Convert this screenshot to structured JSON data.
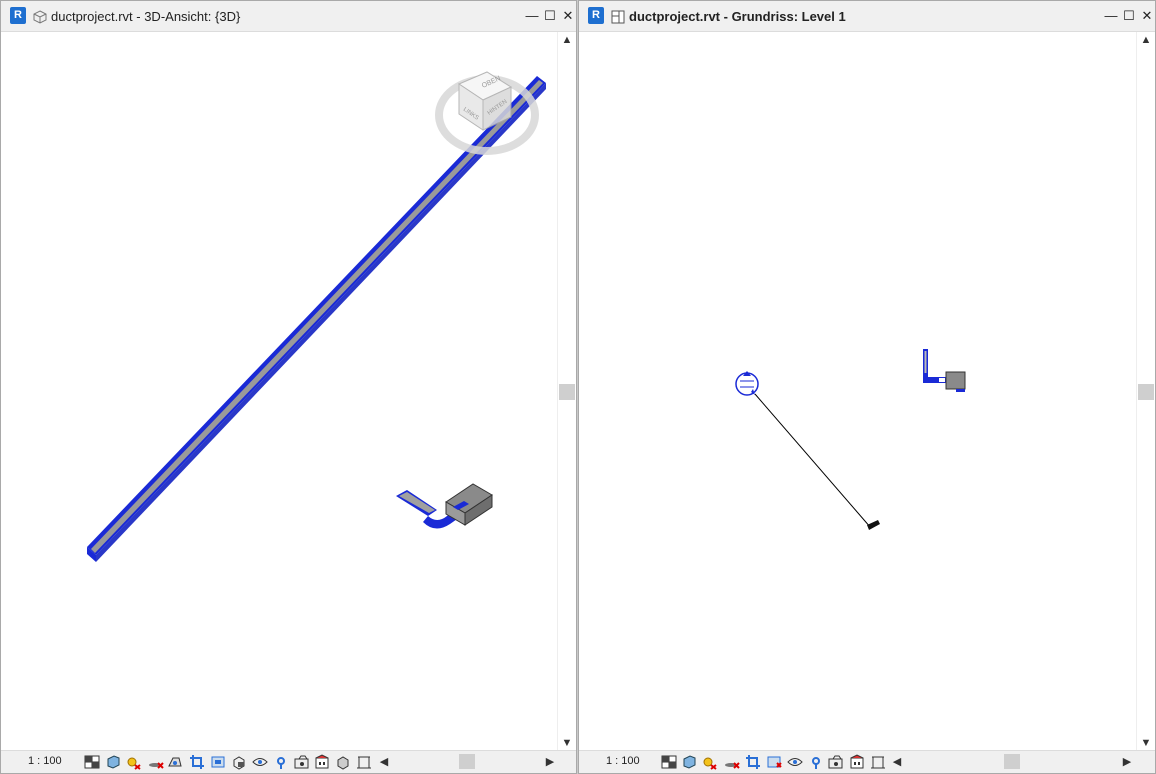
{
  "windows": [
    {
      "title": "ductproject.rvt - 3D-Ansicht: {3D}",
      "scale": "1 : 100",
      "viewcube": {
        "top_label": "OBEN",
        "front_label": "LINKS",
        "side_label": "HINTEN"
      }
    },
    {
      "title": "ductproject.rvt - Grundriss: Level 1",
      "scale": "1 : 100"
    }
  ],
  "window_controls": {
    "minimize": "—",
    "maximize": "☐",
    "close": "✕"
  },
  "app_badge": "R",
  "colors": {
    "duct_blue": "#1a2ad6",
    "duct_gray": "#8a8a8a",
    "selection": "#0000ff"
  },
  "icons": [
    "detail-level-icon",
    "visual-style-icon",
    "sun-path-icon",
    "shadows-icon",
    "render-icon",
    "crop-view-icon",
    "show-crop-icon",
    "unlock-3d-icon",
    "temporary-hide-icon",
    "reveal-hidden-icon",
    "worksharing-icon",
    "analytical-icon",
    "highlight-displacement-icon",
    "reveal-constraints-icon"
  ]
}
